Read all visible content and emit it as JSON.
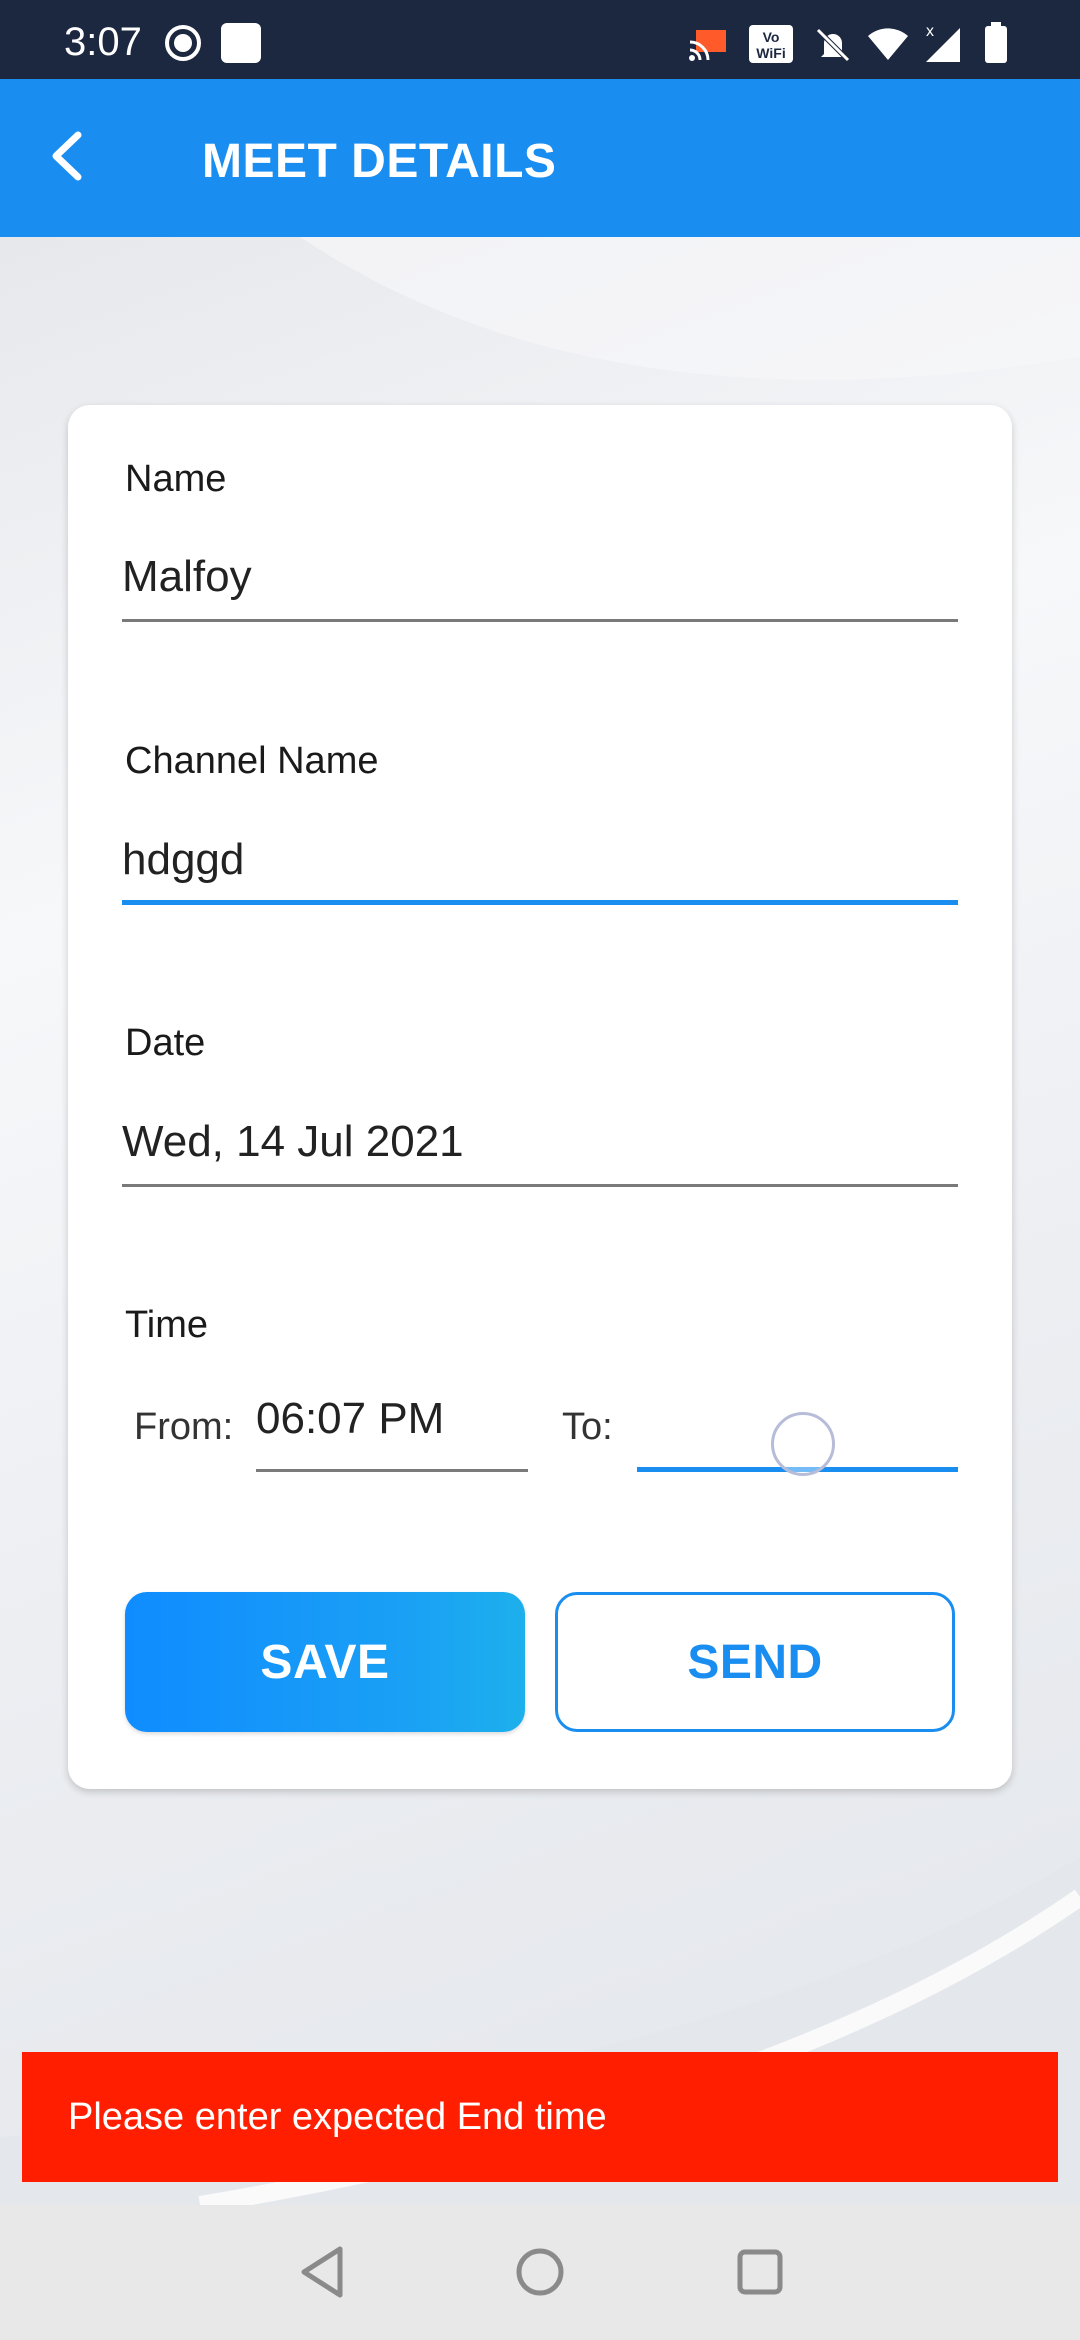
{
  "status_bar": {
    "time": "3:07",
    "icons": [
      "record-icon",
      "square-app-icon",
      "cast-icon",
      "vowifi-icon",
      "mute-icon",
      "wifi-icon",
      "signal-icon",
      "battery-icon"
    ]
  },
  "app_bar": {
    "title": "MEET DETAILS",
    "back_icon": "chevron-left-icon",
    "color": "#1a8ef0"
  },
  "form": {
    "name": {
      "label": "Name",
      "value": "Malfoy"
    },
    "channel": {
      "label": "Channel Name",
      "value": "hdggd"
    },
    "date": {
      "label": "Date",
      "value": "Wed, 14 Jul 2021"
    },
    "time": {
      "label": "Time",
      "from_label": "From:",
      "from_value": "06:07 PM",
      "to_label": "To:",
      "to_value": ""
    }
  },
  "actions": {
    "save_label": "SAVE",
    "send_label": "SEND"
  },
  "snackbar": {
    "message": "Please enter expected End time",
    "color": "#ff1f00"
  },
  "nav_bar": {
    "icons": [
      "back-triangle-icon",
      "home-circle-icon",
      "recents-square-icon"
    ]
  }
}
